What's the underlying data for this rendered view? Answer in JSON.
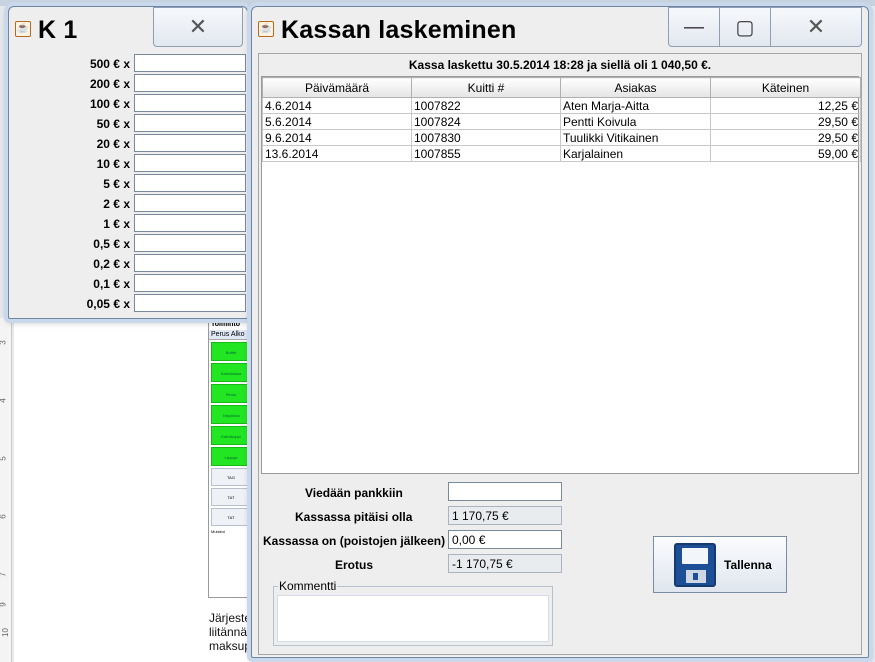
{
  "background": {
    "panel_title": "Toiminto",
    "panel_tabs": "Perus Alko",
    "panel_buttons": [
      "Buffet",
      "Kahviloissa",
      "Perus",
      "Tarjoiluna",
      "Kahvikuppi",
      "Lippuja"
    ],
    "panel_white_buttons": [
      "TAG",
      "TAT",
      "TAT"
    ],
    "panel_footer": "Muistiot",
    "doc_lines": [
      "Järjeste",
      "liitännä",
      "maksup"
    ],
    "ruler_marks": [
      "3",
      "4",
      "5",
      "6",
      "7",
      "8",
      "9",
      "10",
      "11"
    ]
  },
  "k1": {
    "title": "K 1",
    "close_icon": "close-icon",
    "rows": [
      {
        "label": "500 € x",
        "value": ""
      },
      {
        "label": "200 € x",
        "value": ""
      },
      {
        "label": "100 € x",
        "value": ""
      },
      {
        "label": "50 € x",
        "value": ""
      },
      {
        "label": "20 € x",
        "value": ""
      },
      {
        "label": "10 € x",
        "value": ""
      },
      {
        "label": "5 € x",
        "value": ""
      },
      {
        "label": "2 € x",
        "value": ""
      },
      {
        "label": "1 € x",
        "value": ""
      },
      {
        "label": "0,5 € x",
        "value": ""
      },
      {
        "label": "0,2 € x",
        "value": ""
      },
      {
        "label": "0,1 € x",
        "value": ""
      },
      {
        "label": "0,05 € x",
        "value": ""
      }
    ]
  },
  "kassa": {
    "title": "Kassan laskeminen",
    "summary": "Kassa laskettu 30.5.2014 18:28 ja siellä oli 1 040,50 €.",
    "columns": [
      "Päivämäärä",
      "Kuitti #",
      "Asiakas",
      "Käteinen"
    ],
    "rows": [
      [
        "4.6.2014",
        "1007822",
        "Aten Marja-Aitta",
        "12,25 €"
      ],
      [
        "5.6.2014",
        "1007824",
        "Pentti Koivula",
        "29,50 €"
      ],
      [
        "9.6.2014",
        "1007830",
        "Tuulikki Vitikainen",
        "29,50 €"
      ],
      [
        "13.6.2014",
        "1007855",
        "Karjalainen",
        "59,00 €"
      ]
    ],
    "form": {
      "bank_label": "Viedään pankkiin",
      "bank_value": "",
      "should_label": "Kassassa pitäisi olla",
      "should_value": "1 170,75 €",
      "actual_label": "Kassassa on (poistojen jälkeen)",
      "actual_value": "0,00 €",
      "diff_label": "Erotus",
      "diff_value": "-1 170,75 €",
      "comment_legend": "Kommentti",
      "comment_value": ""
    },
    "save_label": "Tallenna",
    "save_icon": "floppy-disk-icon",
    "minimize_icon": "minimize-icon",
    "maximize_icon": "maximize-icon",
    "close_icon": "close-icon"
  }
}
